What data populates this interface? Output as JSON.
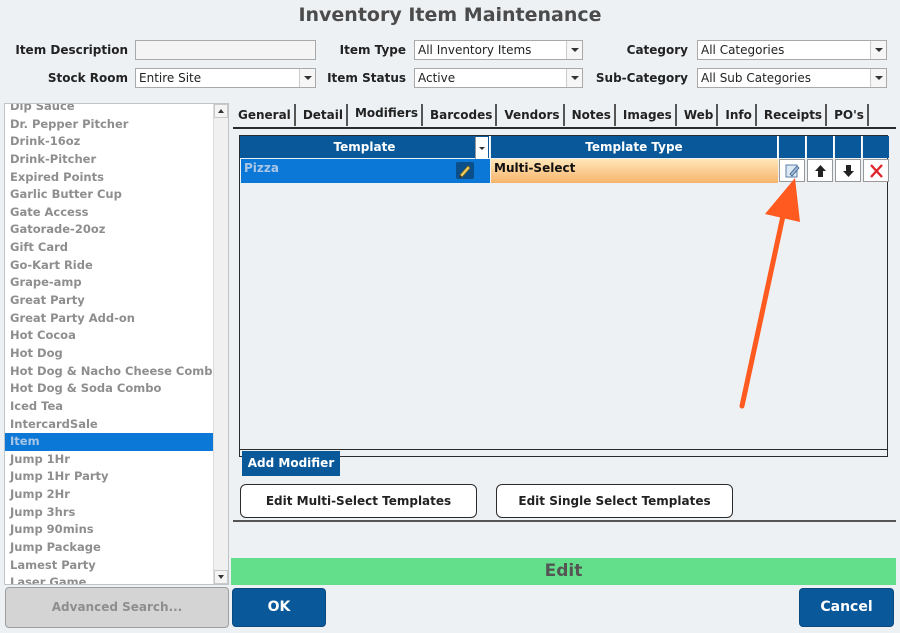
{
  "app": {
    "title": "Inventory Item Maintenance"
  },
  "filters": {
    "item_description_label": "Item Description",
    "item_description_value": "",
    "stock_room_label": "Stock Room",
    "stock_room_value": "Entire Site",
    "item_type_label": "Item Type",
    "item_type_value": "All Inventory Items",
    "item_status_label": "Item Status",
    "item_status_value": "Active",
    "category_label": "Category",
    "category_value": "All Categories",
    "sub_category_label": "Sub-Category",
    "sub_category_value": "All Sub Categories"
  },
  "item_list": {
    "items": [
      "Dip Sauce",
      "Dr. Pepper Pitcher",
      "Drink-16oz",
      "Drink-Pitcher",
      "Expired Points",
      "Garlic Butter Cup",
      "Gate Access",
      "Gatorade-20oz",
      "Gift Card",
      "Go-Kart Ride",
      "Grape-amp",
      "Great Party",
      "Great Party Add-on",
      "Hot Cocoa",
      "Hot Dog",
      "Hot Dog & Nacho Cheese Combo",
      "Hot Dog & Soda Combo",
      "Iced Tea",
      "IntercardSale",
      "Item",
      "Jump 1Hr",
      "Jump 1Hr Party",
      "Jump 2Hr",
      "Jump 3hrs",
      "Jump 90mins",
      "Jump Package",
      "Lamest Party",
      "Laser Game"
    ],
    "selected": "Item"
  },
  "advanced_search_label": "Advanced Search...",
  "tabs": [
    "General",
    "Detail",
    "Modifiers",
    "Barcodes",
    "Vendors",
    "Notes",
    "Images",
    "Web",
    "Info",
    "Receipts",
    "PO's"
  ],
  "active_tab": "Modifiers",
  "modifiers_grid": {
    "col_template": "Template",
    "col_template_type": "Template Type",
    "row": {
      "template": "Pizza",
      "template_type": "Multi-Select"
    }
  },
  "add_modifier_label": "Add Modifier",
  "edit_multi_label": "Edit Multi-Select Templates",
  "edit_single_label": "Edit Single Select Templates",
  "status_text": "Edit",
  "ok_label": "OK",
  "cancel_label": "Cancel",
  "colors": {
    "accent": "#09599a",
    "selection": "#0b78d8",
    "status": "#63df8b",
    "annotation_arrow": "#ff5a1f"
  }
}
